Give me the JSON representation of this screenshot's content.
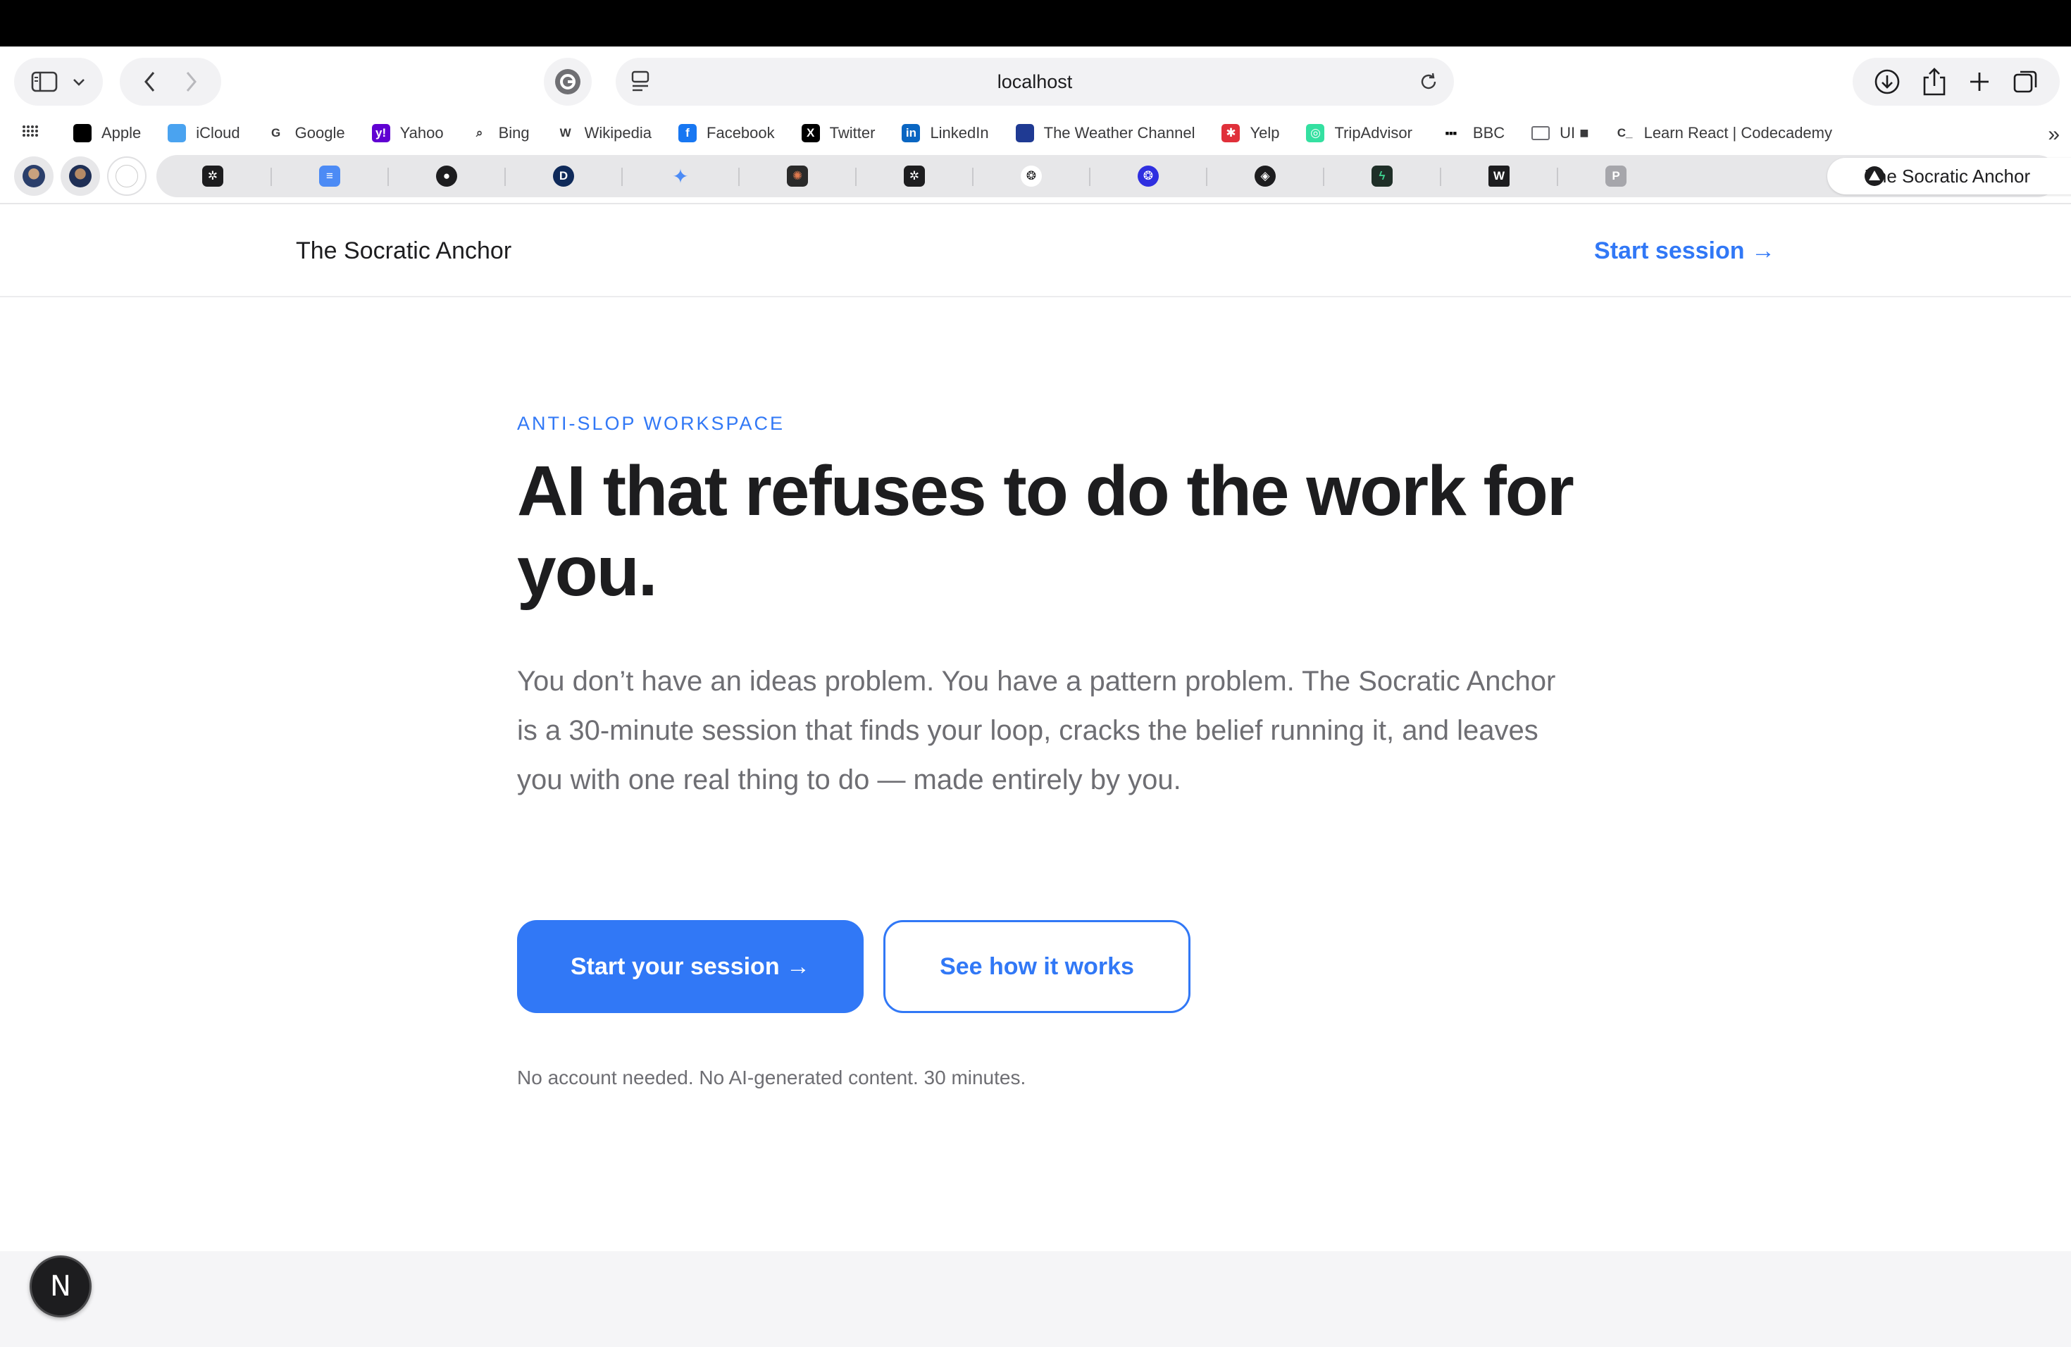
{
  "browser": {
    "url": "localhost",
    "favorites": [
      {
        "label": "Apple",
        "icon": "apple-icon",
        "color": "#000000",
        "glyph": ""
      },
      {
        "label": "iCloud",
        "icon": "icloud-icon",
        "color": "#4aa3f0",
        "glyph": ""
      },
      {
        "label": "Google",
        "icon": "google-icon",
        "color": "#ffffff",
        "glyph": "G"
      },
      {
        "label": "Yahoo",
        "icon": "yahoo-icon",
        "color": "#6001d2",
        "glyph": "y!"
      },
      {
        "label": "Bing",
        "icon": "bing-icon",
        "color": "#ffffff",
        "glyph": "⌕"
      },
      {
        "label": "Wikipedia",
        "icon": "wikipedia-icon",
        "color": "#ffffff",
        "glyph": "W"
      },
      {
        "label": "Facebook",
        "icon": "facebook-icon",
        "color": "#1877f2",
        "glyph": "f"
      },
      {
        "label": "Twitter",
        "icon": "twitter-icon",
        "color": "#000000",
        "glyph": "X"
      },
      {
        "label": "LinkedIn",
        "icon": "linkedin-icon",
        "color": "#0a66c2",
        "glyph": "in"
      },
      {
        "label": "The Weather Channel",
        "icon": "weather-channel-icon",
        "color": "#1f3a93",
        "glyph": ""
      },
      {
        "label": "Yelp",
        "icon": "yelp-icon",
        "color": "#e0303a",
        "glyph": "✱"
      },
      {
        "label": "TripAdvisor",
        "icon": "tripadvisor-icon",
        "color": "#34e0a1",
        "glyph": "◎"
      },
      {
        "label": "BBC",
        "icon": "bbc-icon",
        "color": "#000000",
        "glyph": "■■■"
      },
      {
        "label": "UI ■",
        "icon": "folder-icon",
        "color": "#ffffff",
        "glyph": ""
      },
      {
        "label": "Learn React | Codecademy",
        "icon": "codecademy-icon",
        "color": "#ffffff",
        "glyph": "C_"
      }
    ],
    "active_tab": "The Socratic Anchor"
  },
  "site": {
    "brand": "The Socratic Anchor",
    "header_cta": "Start session →",
    "eyebrow": "ANTI-SLOP WORKSPACE",
    "headline": "AI that refuses to do the work for you.",
    "lede": "You don’t have an ideas problem. You have a pattern problem. The Socratic Anchor is a 30-minute session that finds your loop, cracks the belief running it, and leaves you with one real thing to do — made entirely by you.",
    "primary_button": "Start your session →",
    "secondary_button": "See how it works",
    "fineprint": "No account needed. No AI-generated content. 30 minutes.",
    "next_badge": "N"
  },
  "colors": {
    "accent": "#3178f6",
    "text": "#1d1d1f",
    "muted": "#6e6e73"
  }
}
